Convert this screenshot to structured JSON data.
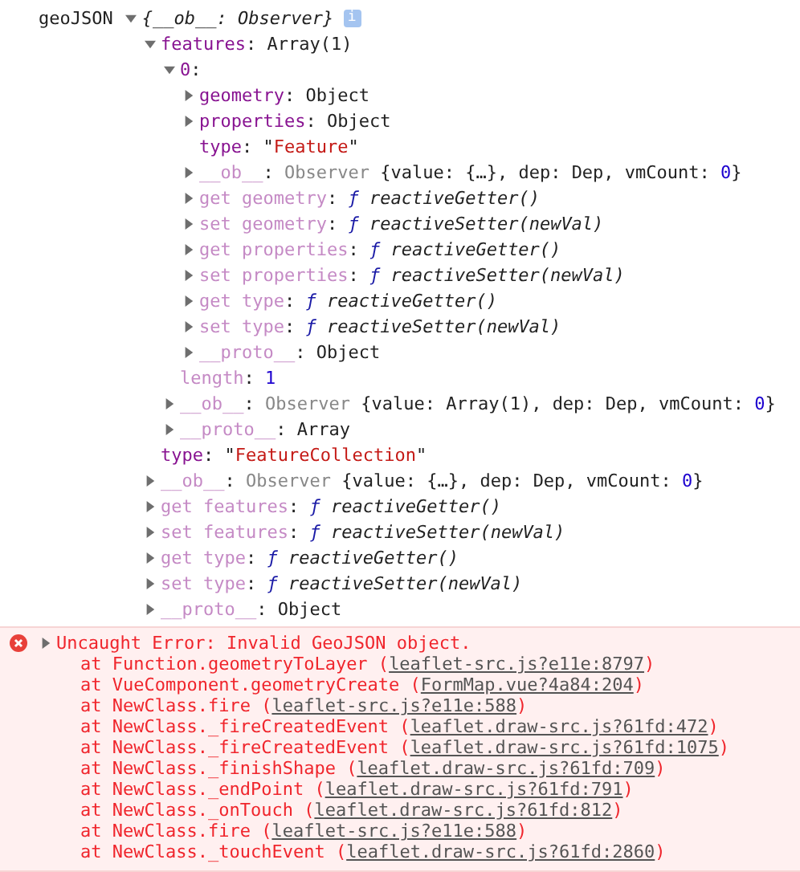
{
  "root": {
    "label": "geoJSON",
    "expanded": true,
    "preview": [
      {
        "text": "{__ob__: Observer}",
        "kind": "italic"
      }
    ],
    "badge": "i",
    "children": [
      {
        "expanded": true,
        "parts": [
          {
            "text": "features",
            "kind": "key"
          },
          {
            "text": ": Array(1)",
            "kind": "plain"
          }
        ],
        "children": [
          {
            "expanded": true,
            "parts": [
              {
                "text": "0",
                "kind": "key"
              },
              {
                "text": ":",
                "kind": "plain"
              }
            ],
            "children": [
              {
                "expanded": false,
                "parts": [
                  {
                    "text": "geometry",
                    "kind": "key"
                  },
                  {
                    "text": ": Object",
                    "kind": "plain"
                  }
                ]
              },
              {
                "expanded": false,
                "parts": [
                  {
                    "text": "properties",
                    "kind": "key"
                  },
                  {
                    "text": ": Object",
                    "kind": "plain"
                  }
                ]
              },
              {
                "parts": [
                  {
                    "text": "type",
                    "kind": "key"
                  },
                  {
                    "text": ": \"",
                    "kind": "plain"
                  },
                  {
                    "text": "Feature",
                    "kind": "str"
                  },
                  {
                    "text": "\"",
                    "kind": "plain"
                  }
                ]
              },
              {
                "expanded": false,
                "parts": [
                  {
                    "text": "__ob__",
                    "kind": "dimkey"
                  },
                  {
                    "text": ": ",
                    "kind": "plain"
                  },
                  {
                    "text": "Observer",
                    "kind": "dim"
                  },
                  {
                    "text": " {value: {…}, dep: Dep, vmCount: ",
                    "kind": "plain"
                  },
                  {
                    "text": "0",
                    "kind": "num"
                  },
                  {
                    "text": "}",
                    "kind": "plain"
                  }
                ]
              },
              {
                "expanded": false,
                "parts": [
                  {
                    "text": "get geometry",
                    "kind": "dimkey"
                  },
                  {
                    "text": ": ",
                    "kind": "plain"
                  },
                  {
                    "text": "ƒ",
                    "kind": "fn"
                  },
                  {
                    "text": " reactiveGetter()",
                    "kind": "italic"
                  }
                ]
              },
              {
                "expanded": false,
                "parts": [
                  {
                    "text": "set geometry",
                    "kind": "dimkey"
                  },
                  {
                    "text": ": ",
                    "kind": "plain"
                  },
                  {
                    "text": "ƒ",
                    "kind": "fn"
                  },
                  {
                    "text": " reactiveSetter(newVal)",
                    "kind": "italic"
                  }
                ]
              },
              {
                "expanded": false,
                "parts": [
                  {
                    "text": "get properties",
                    "kind": "dimkey"
                  },
                  {
                    "text": ": ",
                    "kind": "plain"
                  },
                  {
                    "text": "ƒ",
                    "kind": "fn"
                  },
                  {
                    "text": " reactiveGetter()",
                    "kind": "italic"
                  }
                ]
              },
              {
                "expanded": false,
                "parts": [
                  {
                    "text": "set properties",
                    "kind": "dimkey"
                  },
                  {
                    "text": ": ",
                    "kind": "plain"
                  },
                  {
                    "text": "ƒ",
                    "kind": "fn"
                  },
                  {
                    "text": " reactiveSetter(newVal)",
                    "kind": "italic"
                  }
                ]
              },
              {
                "expanded": false,
                "parts": [
                  {
                    "text": "get type",
                    "kind": "dimkey"
                  },
                  {
                    "text": ": ",
                    "kind": "plain"
                  },
                  {
                    "text": "ƒ",
                    "kind": "fn"
                  },
                  {
                    "text": " reactiveGetter()",
                    "kind": "italic"
                  }
                ]
              },
              {
                "expanded": false,
                "parts": [
                  {
                    "text": "set type",
                    "kind": "dimkey"
                  },
                  {
                    "text": ": ",
                    "kind": "plain"
                  },
                  {
                    "text": "ƒ",
                    "kind": "fn"
                  },
                  {
                    "text": " reactiveSetter(newVal)",
                    "kind": "italic"
                  }
                ]
              },
              {
                "expanded": false,
                "parts": [
                  {
                    "text": "__proto__",
                    "kind": "dimkey"
                  },
                  {
                    "text": ": Object",
                    "kind": "plain"
                  }
                ]
              }
            ]
          },
          {
            "parts": [
              {
                "text": "length",
                "kind": "dimkey"
              },
              {
                "text": ": ",
                "kind": "plain"
              },
              {
                "text": "1",
                "kind": "num"
              }
            ]
          },
          {
            "expanded": false,
            "parts": [
              {
                "text": "__ob__",
                "kind": "dimkey"
              },
              {
                "text": ": ",
                "kind": "plain"
              },
              {
                "text": "Observer",
                "kind": "dim"
              },
              {
                "text": " {value: Array(1), dep: Dep, vmCount: ",
                "kind": "plain"
              },
              {
                "text": "0",
                "kind": "num"
              },
              {
                "text": "}",
                "kind": "plain"
              }
            ]
          },
          {
            "expanded": false,
            "parts": [
              {
                "text": "__proto__",
                "kind": "dimkey"
              },
              {
                "text": ": Array",
                "kind": "plain"
              }
            ]
          }
        ]
      },
      {
        "parts": [
          {
            "text": "type",
            "kind": "key"
          },
          {
            "text": ": \"",
            "kind": "plain"
          },
          {
            "text": "FeatureCollection",
            "kind": "str"
          },
          {
            "text": "\"",
            "kind": "plain"
          }
        ]
      },
      {
        "expanded": false,
        "parts": [
          {
            "text": "__ob__",
            "kind": "dimkey"
          },
          {
            "text": ": ",
            "kind": "plain"
          },
          {
            "text": "Observer",
            "kind": "dim"
          },
          {
            "text": " {value: {…}, dep: Dep, vmCount: ",
            "kind": "plain"
          },
          {
            "text": "0",
            "kind": "num"
          },
          {
            "text": "}",
            "kind": "plain"
          }
        ]
      },
      {
        "expanded": false,
        "parts": [
          {
            "text": "get features",
            "kind": "dimkey"
          },
          {
            "text": ": ",
            "kind": "plain"
          },
          {
            "text": "ƒ",
            "kind": "fn"
          },
          {
            "text": " reactiveGetter()",
            "kind": "italic"
          }
        ]
      },
      {
        "expanded": false,
        "parts": [
          {
            "text": "set features",
            "kind": "dimkey"
          },
          {
            "text": ": ",
            "kind": "plain"
          },
          {
            "text": "ƒ",
            "kind": "fn"
          },
          {
            "text": " reactiveSetter(newVal)",
            "kind": "italic"
          }
        ]
      },
      {
        "expanded": false,
        "parts": [
          {
            "text": "get type",
            "kind": "dimkey"
          },
          {
            "text": ": ",
            "kind": "plain"
          },
          {
            "text": "ƒ",
            "kind": "fn"
          },
          {
            "text": " reactiveGetter()",
            "kind": "italic"
          }
        ]
      },
      {
        "expanded": false,
        "parts": [
          {
            "text": "set type",
            "kind": "dimkey"
          },
          {
            "text": ": ",
            "kind": "plain"
          },
          {
            "text": "ƒ",
            "kind": "fn"
          },
          {
            "text": " reactiveSetter(newVal)",
            "kind": "italic"
          }
        ]
      },
      {
        "expanded": false,
        "parts": [
          {
            "text": "__proto__",
            "kind": "dimkey"
          },
          {
            "text": ": Object",
            "kind": "plain"
          }
        ]
      }
    ]
  },
  "error": {
    "expanded": false,
    "message": "Uncaught Error: Invalid GeoJSON object.",
    "stack": [
      {
        "prefix": "at Function.geometryToLayer (",
        "link": "leaflet-src.js?e11e:8797",
        "suffix": ")"
      },
      {
        "prefix": "at VueComponent.geometryCreate (",
        "link": "FormMap.vue?4a84:204",
        "suffix": ")"
      },
      {
        "prefix": "at NewClass.fire (",
        "link": "leaflet-src.js?e11e:588",
        "suffix": ")"
      },
      {
        "prefix": "at NewClass._fireCreatedEvent (",
        "link": "leaflet.draw-src.js?61fd:472",
        "suffix": ")"
      },
      {
        "prefix": "at NewClass._fireCreatedEvent (",
        "link": "leaflet.draw-src.js?61fd:1075",
        "suffix": ")"
      },
      {
        "prefix": "at NewClass._finishShape (",
        "link": "leaflet.draw-src.js?61fd:709",
        "suffix": ")"
      },
      {
        "prefix": "at NewClass._endPoint (",
        "link": "leaflet.draw-src.js?61fd:791",
        "suffix": ")"
      },
      {
        "prefix": "at NewClass._onTouch (",
        "link": "leaflet.draw-src.js?61fd:812",
        "suffix": ")"
      },
      {
        "prefix": "at NewClass.fire (",
        "link": "leaflet-src.js?e11e:588",
        "suffix": ")"
      },
      {
        "prefix": "at NewClass._touchEvent (",
        "link": "leaflet.draw-src.js?61fd:2860",
        "suffix": ")"
      }
    ]
  }
}
